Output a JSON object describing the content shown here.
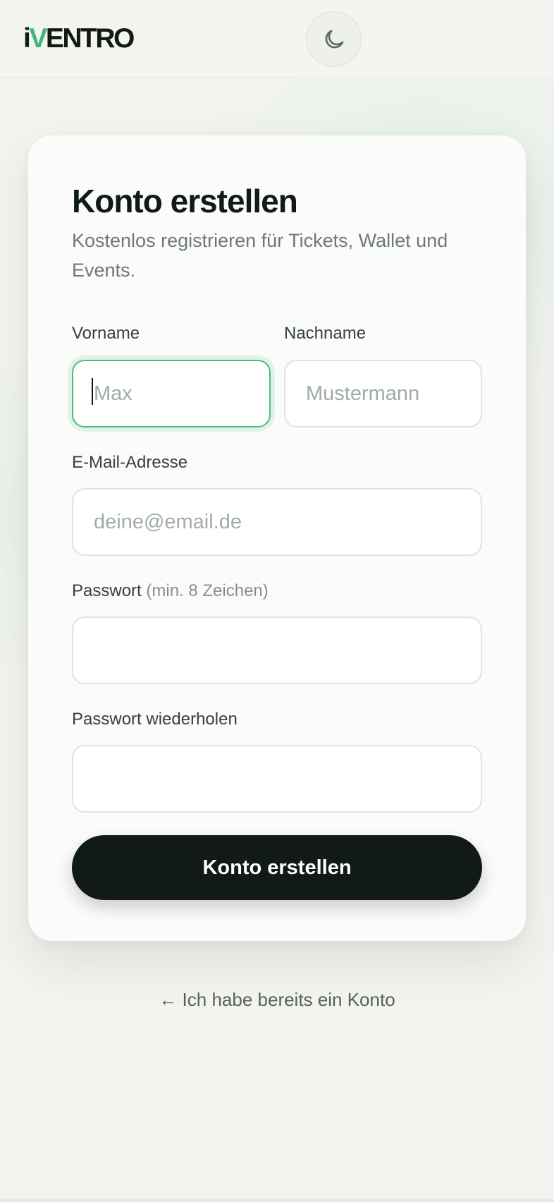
{
  "header": {
    "logo_prefix": "i",
    "logo_accent": "V",
    "logo_suffix": "ENTRO",
    "theme_toggle_icon": "moon-icon"
  },
  "form": {
    "title": "Konto erstellen",
    "subtitle": "Kostenlos registrieren für Tickets, Wallet und Events.",
    "first_name": {
      "label": "Vorname",
      "placeholder": "Max",
      "value": ""
    },
    "last_name": {
      "label": "Nachname",
      "placeholder": "Mustermann",
      "value": ""
    },
    "email": {
      "label": "E-Mail-Adresse",
      "placeholder": "deine@email.de",
      "value": ""
    },
    "password": {
      "label": "Passwort",
      "hint": "(min. 8 Zeichen)",
      "value": ""
    },
    "password_repeat": {
      "label": "Passwort wiederholen",
      "value": ""
    },
    "submit_label": "Konto erstellen"
  },
  "login_link": "← Ich habe bereits ein Konto",
  "colors": {
    "accent": "#3eb878",
    "primary_button": "#111a15",
    "background": "#f3f4f0",
    "focus_ring": "#4dbb82"
  }
}
